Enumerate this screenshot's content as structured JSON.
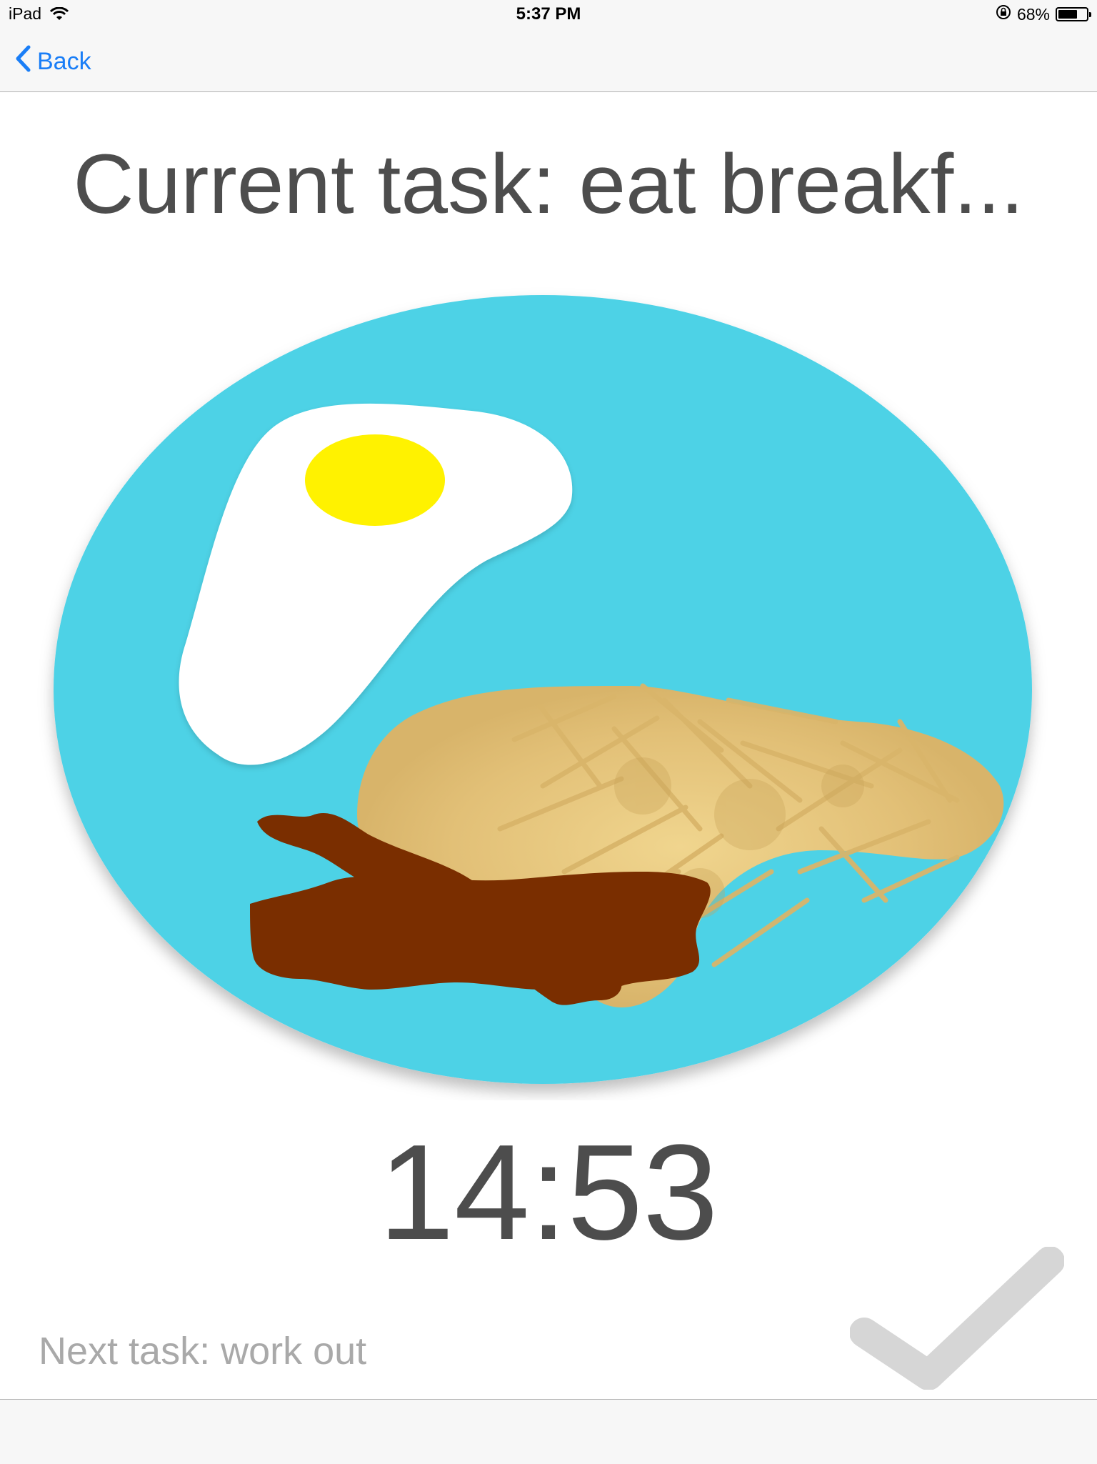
{
  "status_bar": {
    "device": "iPad",
    "time": "5:37 PM",
    "battery": "68%",
    "battery_level": 0.68
  },
  "nav": {
    "back_label": "Back"
  },
  "current_task": "Current task: eat breakf...",
  "illustration": {
    "icon": "breakfast-plate-icon",
    "plate_color": "#4dd2e6",
    "yolk_color": "#ffee00",
    "bacon_color": "#7a2e00",
    "hashbrown_color": "#e3c37c"
  },
  "timer": "14:53",
  "next_task": "Next task: work out",
  "complete_icon": "checkmark-icon",
  "colors": {
    "accent": "#1a7ef7",
    "text": "#4d4d4d",
    "muted": "#a9a9a9"
  }
}
